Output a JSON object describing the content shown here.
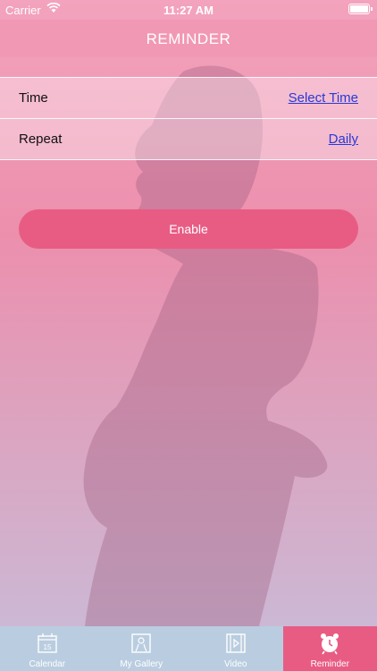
{
  "status_bar": {
    "carrier": "Carrier",
    "time": "11:27 AM"
  },
  "header": {
    "title": "REMINDER"
  },
  "settings": {
    "time": {
      "label": "Time",
      "value": "Select Time"
    },
    "repeat": {
      "label": "Repeat",
      "value": "Daily"
    }
  },
  "enable_button": {
    "label": "Enable"
  },
  "tab_bar": {
    "tabs": [
      {
        "label": "Calendar",
        "icon": "calendar-icon"
      },
      {
        "label": "My Gallery",
        "icon": "gallery-icon"
      },
      {
        "label": "Video",
        "icon": "video-icon"
      },
      {
        "label": "Reminder",
        "icon": "alarm-clock-icon",
        "active": true
      }
    ]
  },
  "colors": {
    "accent": "#e85c84",
    "tab_bar": "#bacde0",
    "link": "#2838d8"
  }
}
